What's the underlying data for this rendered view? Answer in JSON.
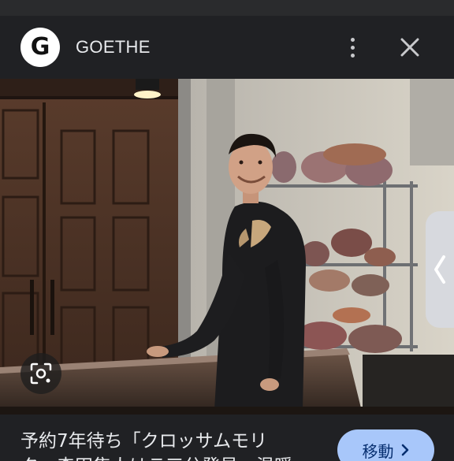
{
  "header": {
    "logo_letter": "G",
    "site_name": "GOETHE"
  },
  "caption": {
    "title_line1": "予約7年待ち「クロッサムモリ",
    "title_line2": "タ」森田隼人はラ三分発見、温暖",
    "visit_label": "移動"
  },
  "icons": {
    "more": "more-vert-icon",
    "close": "close-icon",
    "lens": "lens-search-icon",
    "side_tab": "chevron-left-icon",
    "visit": "chevron-right-icon"
  },
  "colors": {
    "background": "#202124",
    "button_bg": "#a8c7fa",
    "button_text": "#062e6f"
  }
}
